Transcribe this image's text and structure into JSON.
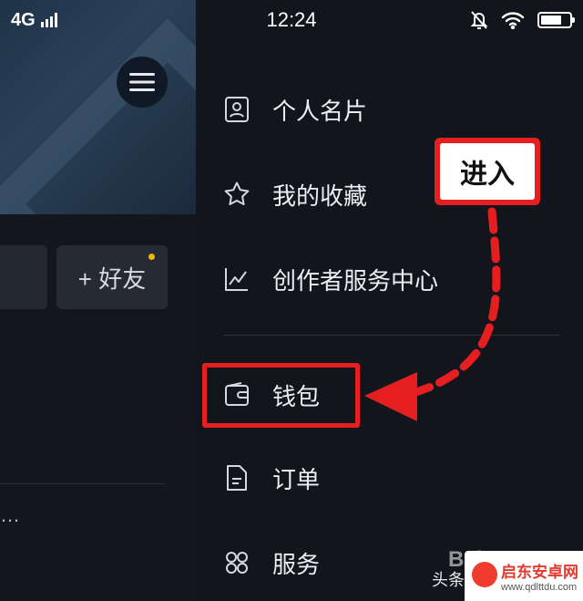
{
  "status_bar": {
    "network": "4G",
    "time": "12:24",
    "icons": [
      "signal-icon",
      "mute-bell-icon",
      "wifi-icon",
      "battery-icon"
    ]
  },
  "profile": {
    "add_friend_label": "+ 好友",
    "truncated_text": "…"
  },
  "drawer": {
    "items": [
      {
        "label": "个人名片",
        "icon": "contact-card-icon"
      },
      {
        "label": "我的收藏",
        "icon": "star-icon"
      },
      {
        "label": "创作者服务中心",
        "icon": "trend-chart-icon"
      },
      {
        "label": "钱包",
        "icon": "wallet-icon"
      },
      {
        "label": "订单",
        "icon": "document-icon"
      },
      {
        "label": "服务",
        "icon": "grid-clover-icon"
      }
    ]
  },
  "annotation": {
    "callout_text": "进入",
    "highlight_color": "#e51f20"
  },
  "watermarks": {
    "toutiao": "头条",
    "baidu": "Bai",
    "site_name": "启东安卓网",
    "site_url": "www.qdlttdu.com"
  }
}
